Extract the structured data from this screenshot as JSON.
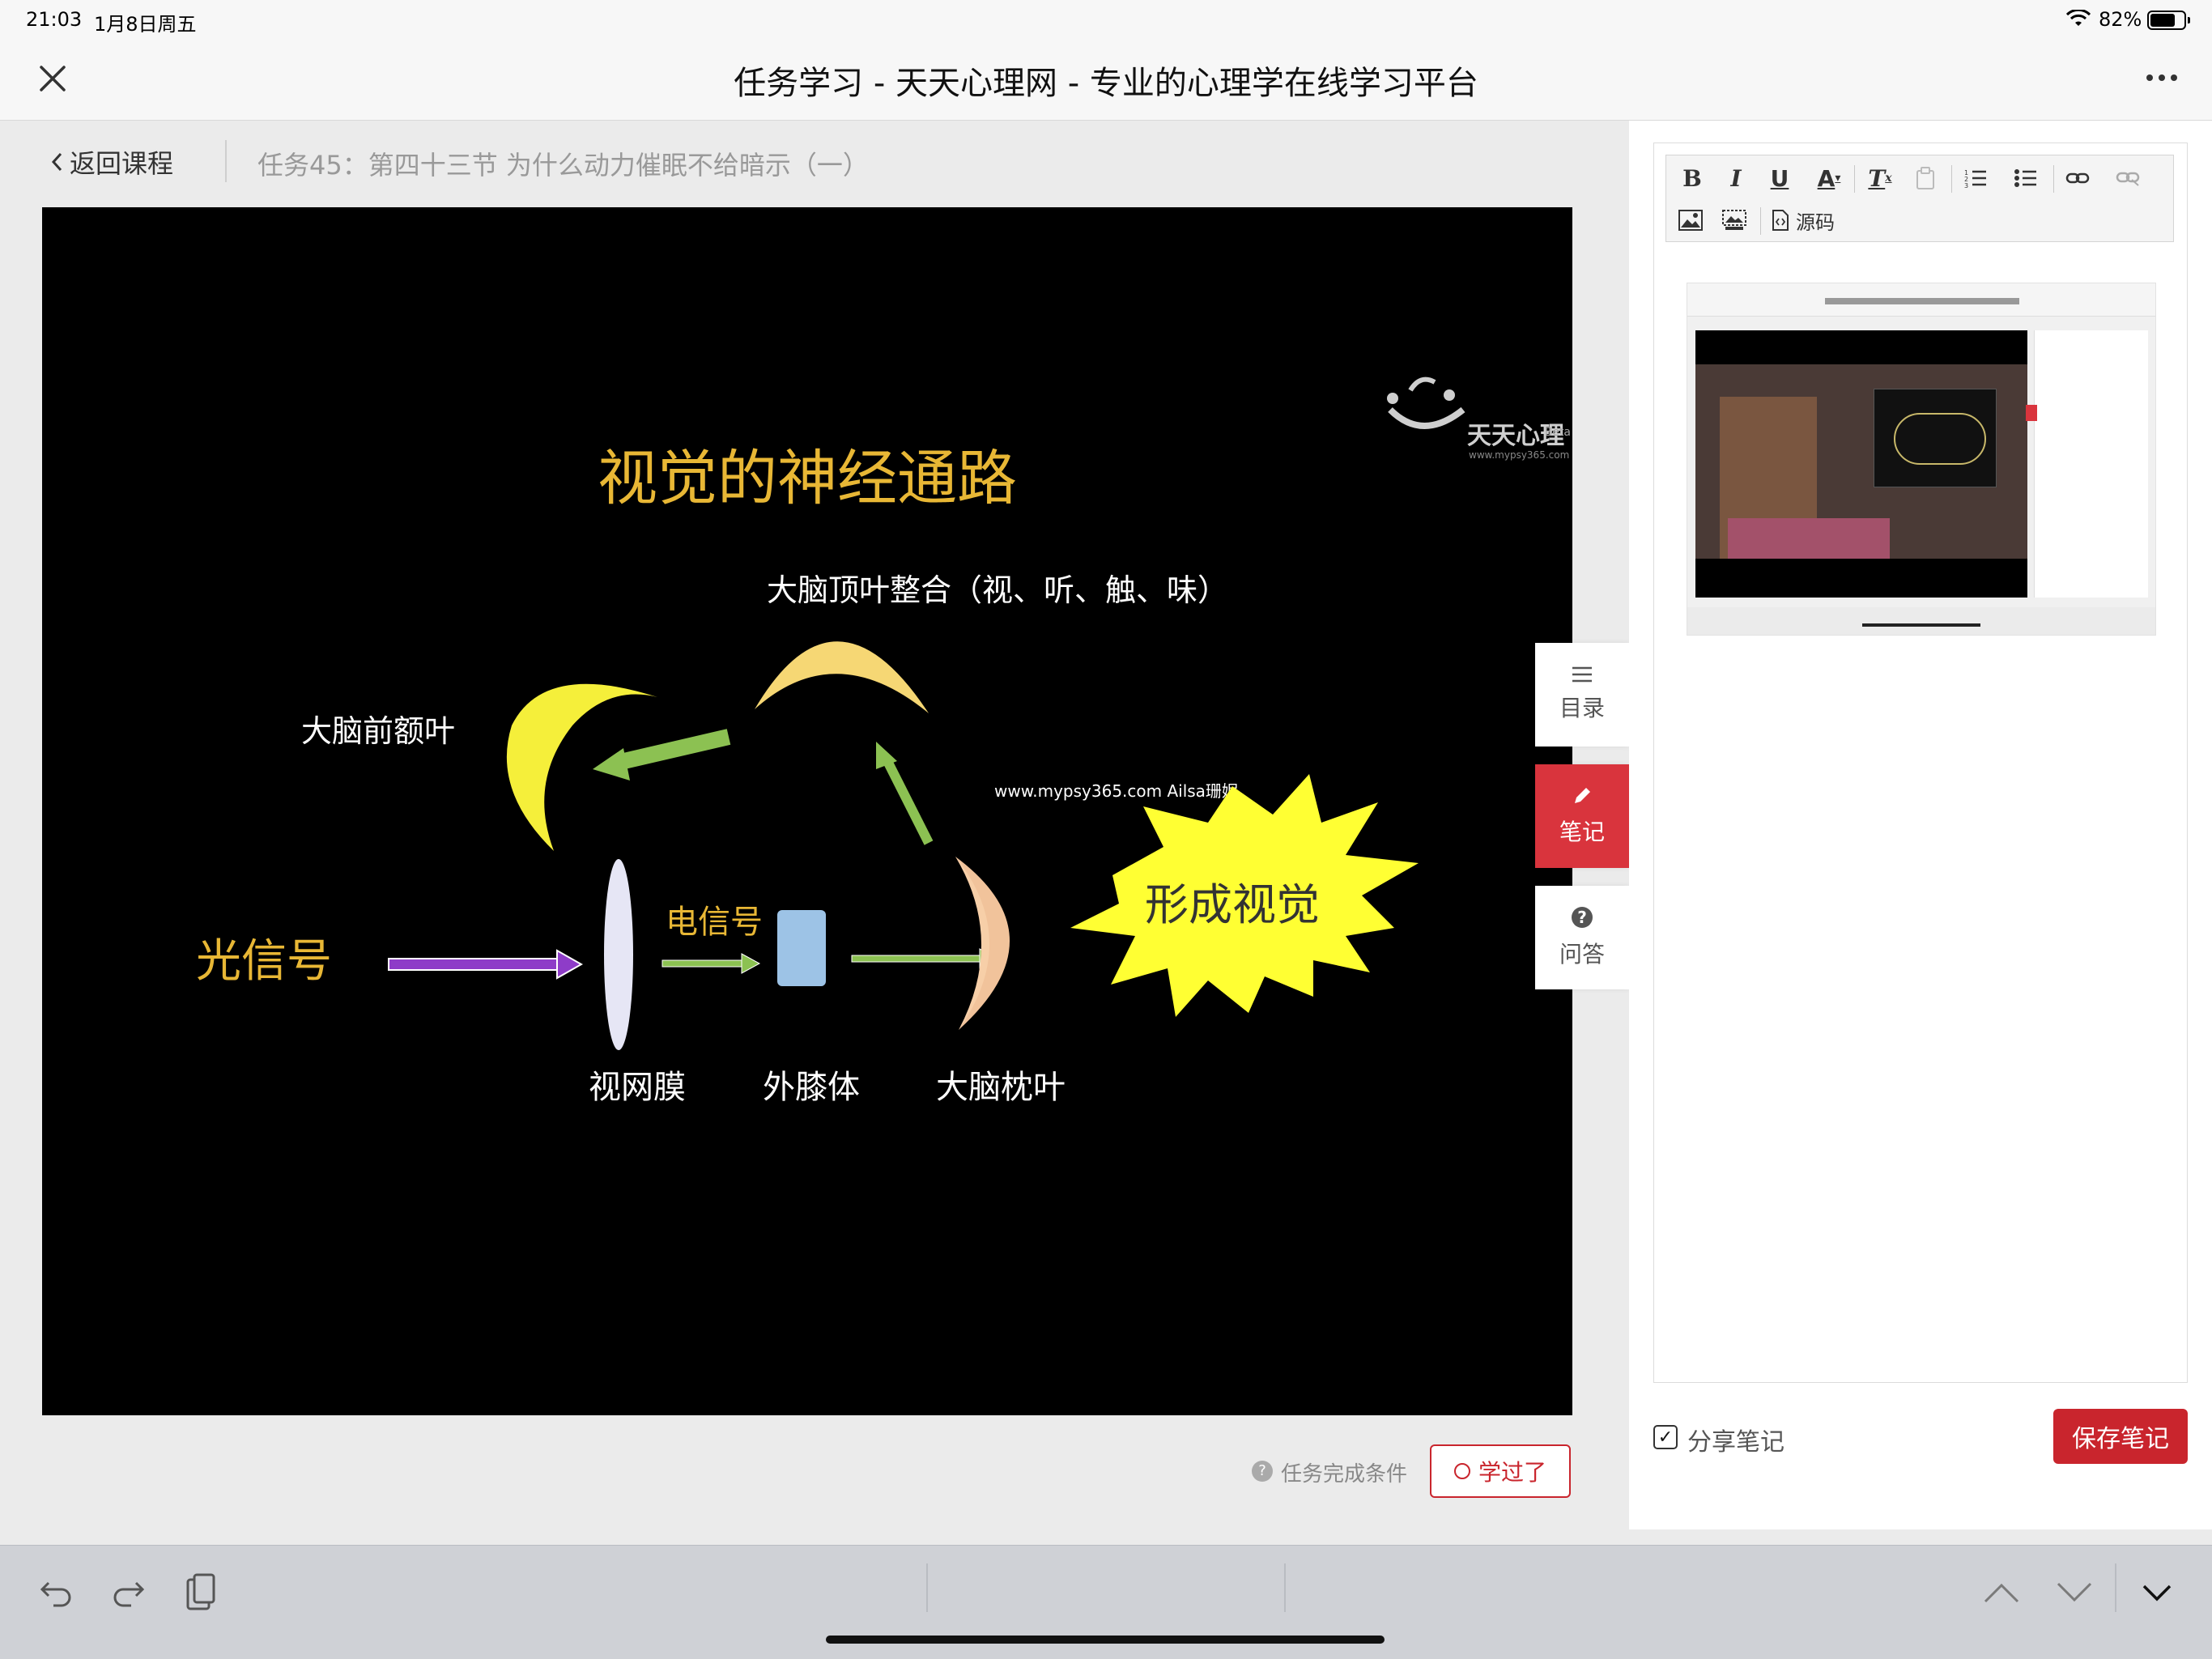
{
  "status_bar": {
    "time": "21:03",
    "date": "1月8日周五",
    "battery": "82%",
    "battery_level": 0.82
  },
  "header": {
    "title": "任务学习 - 天天心理网 - 专业的心理学在线学习平台"
  },
  "breadcrumb": {
    "back": "返回课程",
    "task": "任务45：第四十三节 为什么动力催眠不给暗示（一）"
  },
  "slide": {
    "logo_name": "天天心理",
    "logo_beta": "Beta",
    "logo_url": "www.mypsy365.com",
    "title": "视觉的神经通路",
    "labels": {
      "parietal": "大脑顶叶整合（视、听、触、味）",
      "prefrontal": "大脑前额叶",
      "watermark": "www.mypsy365.com Ailsa珊妮",
      "light_signal": "光信号",
      "electric_signal": "电信号",
      "vision": "形成视觉",
      "retina": "视网膜",
      "lgn": "外膝体",
      "occipital": "大脑枕叶"
    }
  },
  "lesson_footer": {
    "condition": "任务完成条件",
    "learned_button": "学过了"
  },
  "side_tabs": [
    {
      "label": "目录",
      "icon": "menu-icon"
    },
    {
      "label": "笔记",
      "icon": "pencil-icon",
      "active": true
    },
    {
      "label": "问答",
      "icon": "question-icon"
    }
  ],
  "editor": {
    "toolbar": [
      "bold",
      "italic",
      "underline",
      "font-color",
      "clear-format",
      "paste",
      "ordered-list",
      "bullet-list",
      "link",
      "unlink",
      "image",
      "gallery",
      "source"
    ],
    "source_label": "源码",
    "share_label": "分享笔记",
    "share_checked": true,
    "save_button": "保存笔记"
  },
  "colors": {
    "accent": "#c9252d",
    "slide_title": "#e8b735",
    "arrow_green": "#8cc152",
    "arrow_purple": "#8e3cc8"
  }
}
